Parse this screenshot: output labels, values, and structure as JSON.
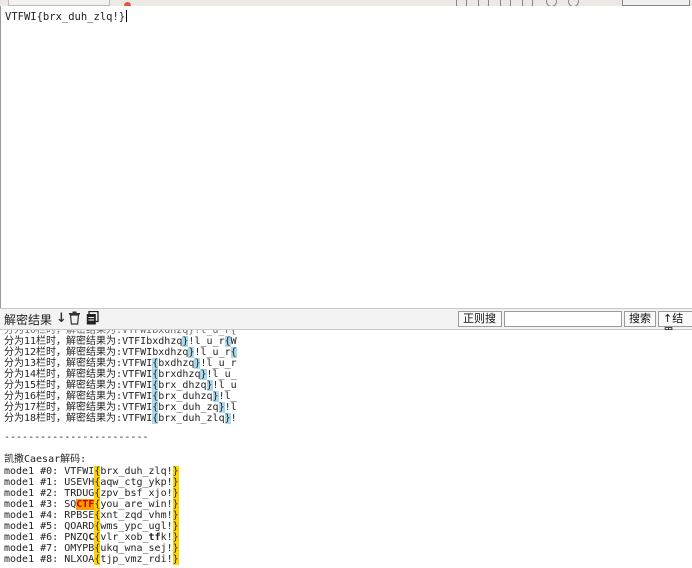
{
  "input": {
    "text": "VTFWI{brx_duh_zlq!}"
  },
  "toolbar": {
    "title": "解密结果",
    "regex_label": "正则搜",
    "search_label": "搜索",
    "result_label": "↑结果"
  },
  "fence_lines": [
    {
      "prefix": "分为11栏时，解密结果为:",
      "body": "VTFIbxdhzq}!l_u_r{W"
    },
    {
      "prefix": "分为12栏时，解密结果为:",
      "body": "VTFWIbxdhzq}!l_u_r{"
    },
    {
      "prefix": "分为13栏时，解密结果为:",
      "body": "VTFWI{bxdhzq}!l_u_r"
    },
    {
      "prefix": "分为14栏时，解密结果为:",
      "body": "VTFWI{brxdhzq}!l_u_"
    },
    {
      "prefix": "分为15栏时，解密结果为:",
      "body": "VTFWI{brx_dhzq}!l_u"
    },
    {
      "prefix": "分为16栏时，解密结果为:",
      "body": "VTFWI{brx_duhzq}!l_"
    },
    {
      "prefix": "分为17栏时，解密结果为:",
      "body": "VTFWI{brx_duh_zq}!l"
    },
    {
      "prefix": "分为18栏时，解密结果为:",
      "body": "VTFWI{brx_duh_zlq}!"
    }
  ],
  "separator": "------------------------",
  "caesar_title": "凯撒Caesar解码:",
  "caesar_lines": [
    {
      "label": "mode1 #0:",
      "a": "VTFWI",
      "b": "brx_duh_zlq!"
    },
    {
      "label": "mode1 #1:",
      "a": "USEVH",
      "b": "aqw_ctg_ykp!"
    },
    {
      "label": "mode1 #2:",
      "a": "TRDUG",
      "b": "zpv_bsf_xjo!"
    },
    {
      "label": "mode1 #3:",
      "a": "SQCTF",
      "b": "you_are_win!"
    },
    {
      "label": "mode1 #4:",
      "a": "RPBSE",
      "b": "xnt_zqd_vhm!"
    },
    {
      "label": "mode1 #5:",
      "a": "QOARD",
      "b": "wms_ypc_ugl!"
    },
    {
      "label": "mode1 #6:",
      "a": "PNZQC",
      "b": "vlr_xob_tfk!"
    },
    {
      "label": "mode1 #7:",
      "a": "OMYPB",
      "b": "ukq_wna_sej!"
    },
    {
      "label": "mode1 #8:",
      "a": "NLXOA",
      "b": "tjp_vmz_rdi!"
    }
  ],
  "colors": {
    "brace_blue": "#aad8ee",
    "brace_yellow": "#ffd200",
    "ctf_highlight": "#ff9a00"
  }
}
